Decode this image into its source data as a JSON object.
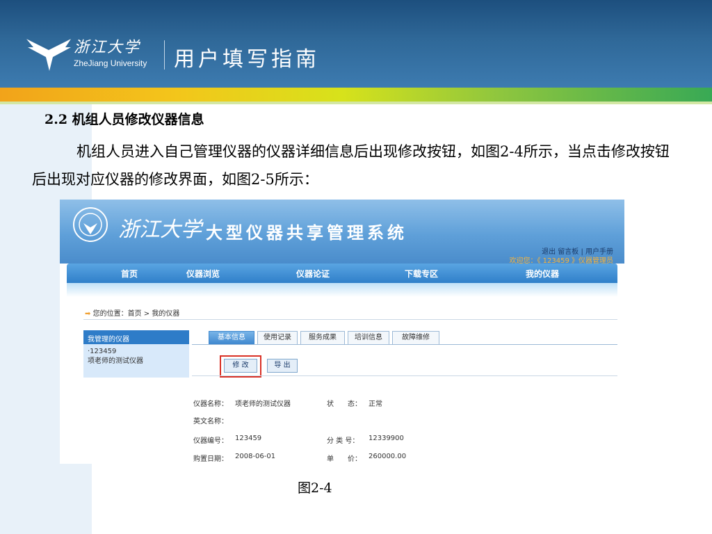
{
  "header": {
    "university_cn": "浙江大学",
    "university_en": "ZheJiang University",
    "title": "用户填写指南"
  },
  "section": {
    "title": "2.2 机组人员修改仪器信息",
    "paragraph": "机组人员进入自己管理仪器的仪器详细信息后出现修改按钮，如图2-4所示，当点击修改按钮后出现对应仪器的修改界面，如图2-5所示："
  },
  "screenshot": {
    "university": "浙江大学",
    "system_title": "大型仪器共享管理系统",
    "top_links": "退出  留言板 | 用户手册",
    "welcome": "欢迎您：《 123459 》仪器管理员",
    "nav": [
      "首页",
      "仪器浏览",
      "仪器论证",
      "下载专区",
      "我的仪器"
    ],
    "breadcrumb": "您的位置：首页 > 我的仪器",
    "sidebar": {
      "header": "我管理的仪器",
      "item_id": "·123459",
      "item_name": "项老师的测试仪器"
    },
    "tabs": [
      "基本信息",
      "使用记录",
      "服务成果",
      "培训信息",
      "故障维修"
    ],
    "buttons": {
      "edit": "修 改",
      "export": "导 出"
    },
    "fields": {
      "name_label": "仪器名称：",
      "name_value": "项老师的测试仪器",
      "status_label": "状　　态：",
      "status_value": "正常",
      "en_name_label": "英文名称：",
      "id_label": "仪器编号：",
      "id_value": "123459",
      "class_label": "分 类 号：",
      "class_value": "12339900",
      "date_label": "购置日期：",
      "date_value": "2008-06-01",
      "price_label": "单　　价：",
      "price_value": "260000.00"
    }
  },
  "caption": "图2-4",
  "colors": {
    "header": "#2f6898",
    "nav": "#2f7fc9",
    "highlight": "#d93025"
  }
}
